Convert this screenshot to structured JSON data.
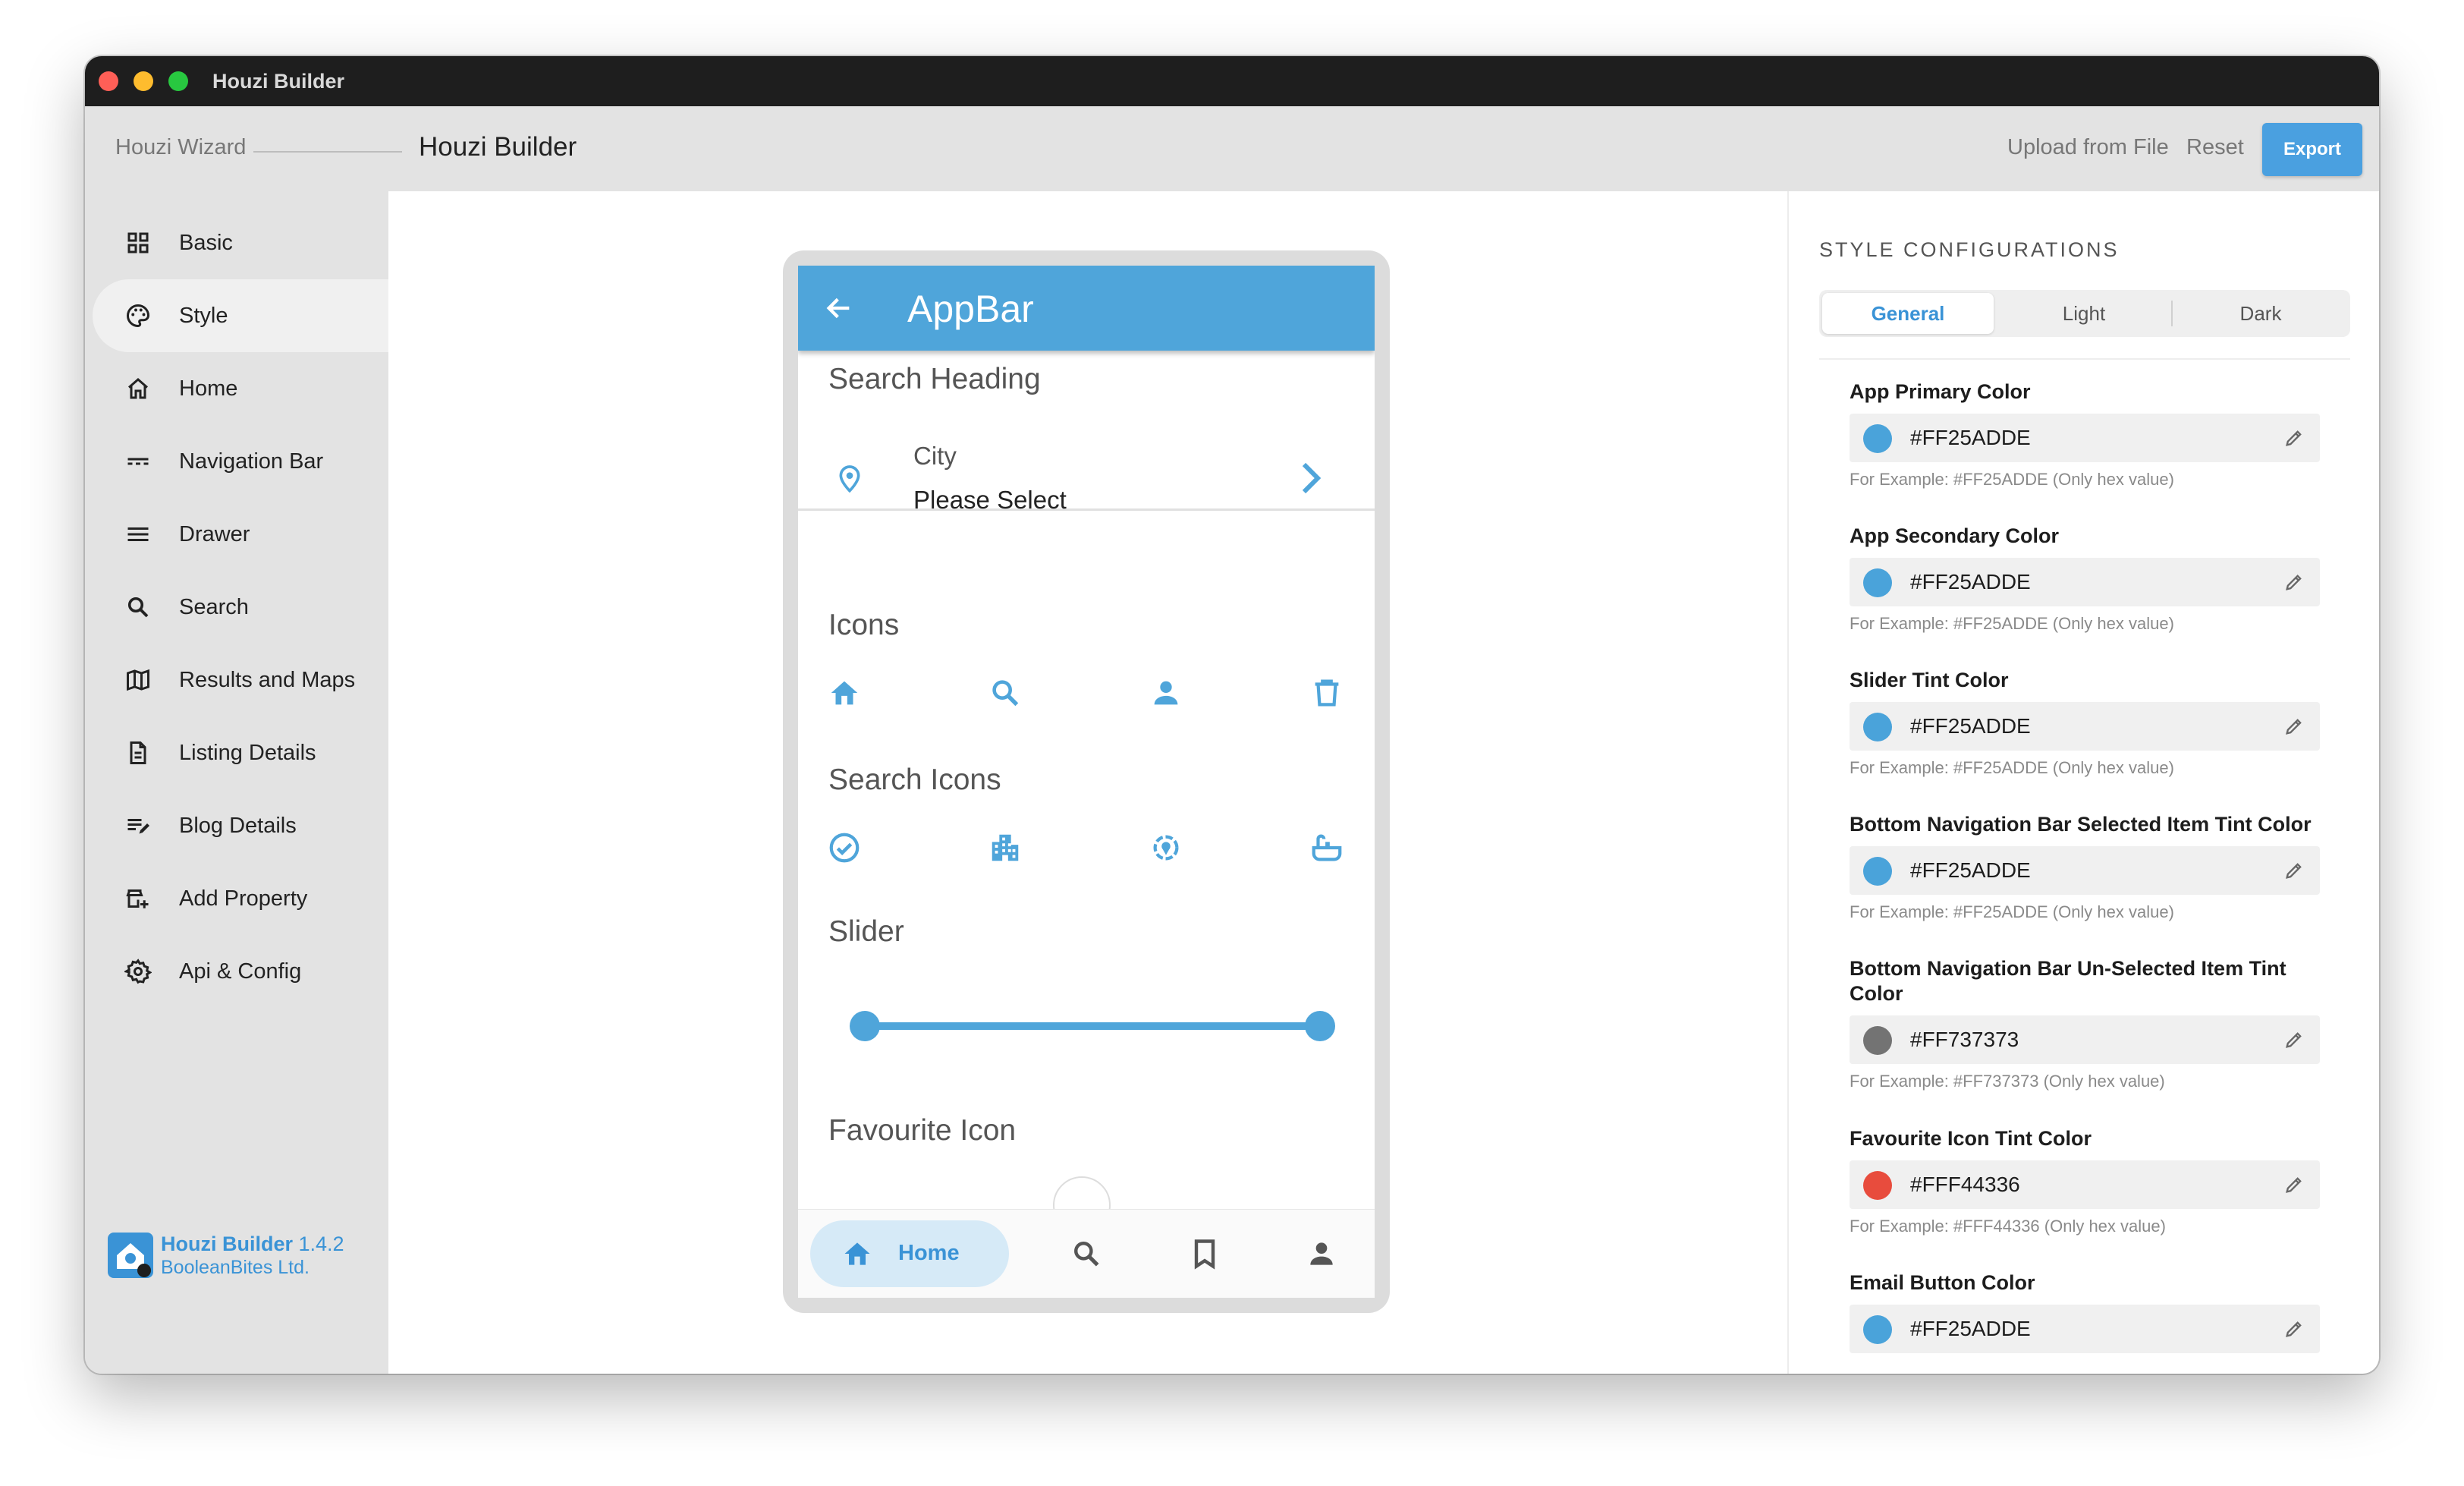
{
  "window": {
    "title": "Houzi Builder"
  },
  "header": {
    "wizard_label": "Houzi Wizard",
    "builder_label": "Houzi Builder",
    "upload_label": "Upload from File",
    "reset_label": "Reset",
    "export_label": "Export"
  },
  "sidebar": {
    "items": [
      {
        "label": "Basic",
        "icon": "grid-icon"
      },
      {
        "label": "Style",
        "icon": "palette-icon",
        "active": true
      },
      {
        "label": "Home",
        "icon": "home-icon"
      },
      {
        "label": "Navigation Bar",
        "icon": "navigation-bar-icon"
      },
      {
        "label": "Drawer",
        "icon": "menu-icon"
      },
      {
        "label": "Search",
        "icon": "search-icon"
      },
      {
        "label": "Results and Maps",
        "icon": "map-icon"
      },
      {
        "label": "Listing Details",
        "icon": "document-icon"
      },
      {
        "label": "Blog Details",
        "icon": "edit-note-icon"
      },
      {
        "label": "Add Property",
        "icon": "add-business-icon"
      },
      {
        "label": "Api & Config",
        "icon": "gear-icon"
      }
    ],
    "brand": {
      "name": "Houzi Builder",
      "version": "1.4.2",
      "company": "BooleanBites Ltd."
    }
  },
  "preview": {
    "appbar_title": "AppBar",
    "search_heading": "Search Heading",
    "city_label": "City",
    "city_value": "Please Select",
    "icons_title": "Icons",
    "search_icons_title": "Search Icons",
    "slider_title": "Slider",
    "slider": {
      "min": 0,
      "max": 1,
      "low": 0,
      "high": 1
    },
    "favourite_title": "Favourite Icon",
    "bottom_nav": {
      "home_label": "Home"
    },
    "accent": "#4fa5da"
  },
  "config": {
    "title": "STYLE CONFIGURATIONS",
    "tabs": [
      "General",
      "Light",
      "Dark"
    ],
    "active_tab": "General",
    "fields": [
      {
        "label": "App Primary Color",
        "value": "#FF25ADDE",
        "swatch": "#4aa3da",
        "hint": "For Example: #FF25ADDE (Only hex value)"
      },
      {
        "label": "App Secondary Color",
        "value": "#FF25ADDE",
        "swatch": "#4aa3da",
        "hint": "For Example: #FF25ADDE (Only hex value)"
      },
      {
        "label": "Slider Tint Color",
        "value": "#FF25ADDE",
        "swatch": "#4aa3da",
        "hint": "For Example: #FF25ADDE (Only hex value)"
      },
      {
        "label": "Bottom Navigation Bar Selected Item Tint Color",
        "value": "#FF25ADDE",
        "swatch": "#4aa3da",
        "hint": "For Example: #FF25ADDE (Only hex value)"
      },
      {
        "label": "Bottom Navigation Bar Un-Selected Item Tint Color",
        "value": "#FF737373",
        "swatch": "#737373",
        "hint": "For Example: #FF737373 (Only hex value)"
      },
      {
        "label": "Favourite Icon Tint Color",
        "value": "#FFF44336",
        "swatch": "#e84c3d",
        "hint": "For Example: #FFF44336 (Only hex value)"
      },
      {
        "label": "Email Button Color",
        "value": "#FF25ADDE",
        "swatch": "#4aa3da",
        "hint": ""
      }
    ]
  }
}
